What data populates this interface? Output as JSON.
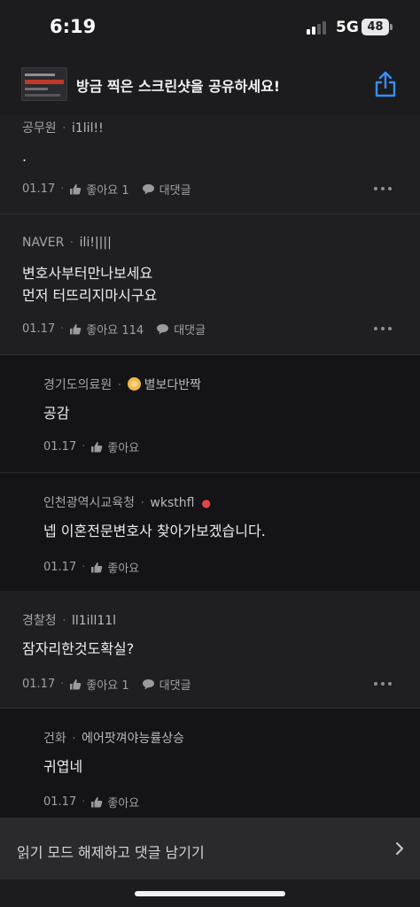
{
  "status_bar": {
    "time": "6:19",
    "network": "5G",
    "battery": "48"
  },
  "share_banner": {
    "text": "방금 찍은 스크린샷을 공유하세요!"
  },
  "comments": [
    {
      "org": "공무원",
      "nickname": "i1lil!!",
      "body": [
        "."
      ],
      "date": "01.17",
      "like_label": "좋아요 1",
      "reply_label": "대댓글"
    },
    {
      "org": "NAVER",
      "nickname": "ili!||||",
      "body": [
        "변호사부터만나보세요",
        "먼저 터뜨리지마시구요"
      ],
      "date": "01.17",
      "like_label": "좋아요 114",
      "reply_label": "대댓글"
    },
    {
      "org": "경기도의료원",
      "nickname": "별보다반짝",
      "body": [
        "공감"
      ],
      "date": "01.17",
      "like_label": "좋아요"
    },
    {
      "org": "인천광역시교육청",
      "nickname": "wksthfl",
      "body": [
        "넵 이혼전문변호사 찾아가보겠습니다."
      ],
      "date": "01.17",
      "like_label": "좋아요"
    },
    {
      "org": "경찰청",
      "nickname": "ll1ill11l",
      "body": [
        "잠자리한것도확실?"
      ],
      "date": "01.17",
      "like_label": "좋아요 1",
      "reply_label": "대댓글"
    },
    {
      "org": "건화",
      "nickname": "에어팟껴야능률상승",
      "body": [
        "귀엽네"
      ],
      "date": "01.17",
      "like_label": "좋아요"
    }
  ],
  "bottom_bar": {
    "text": "읽기 모드 해제하고 댓글 남기기"
  },
  "colors": {
    "background": "#1f1f21",
    "reply_background": "#141416",
    "accent_blue": "#3a8ef6",
    "author_dot": "#e0454a"
  }
}
